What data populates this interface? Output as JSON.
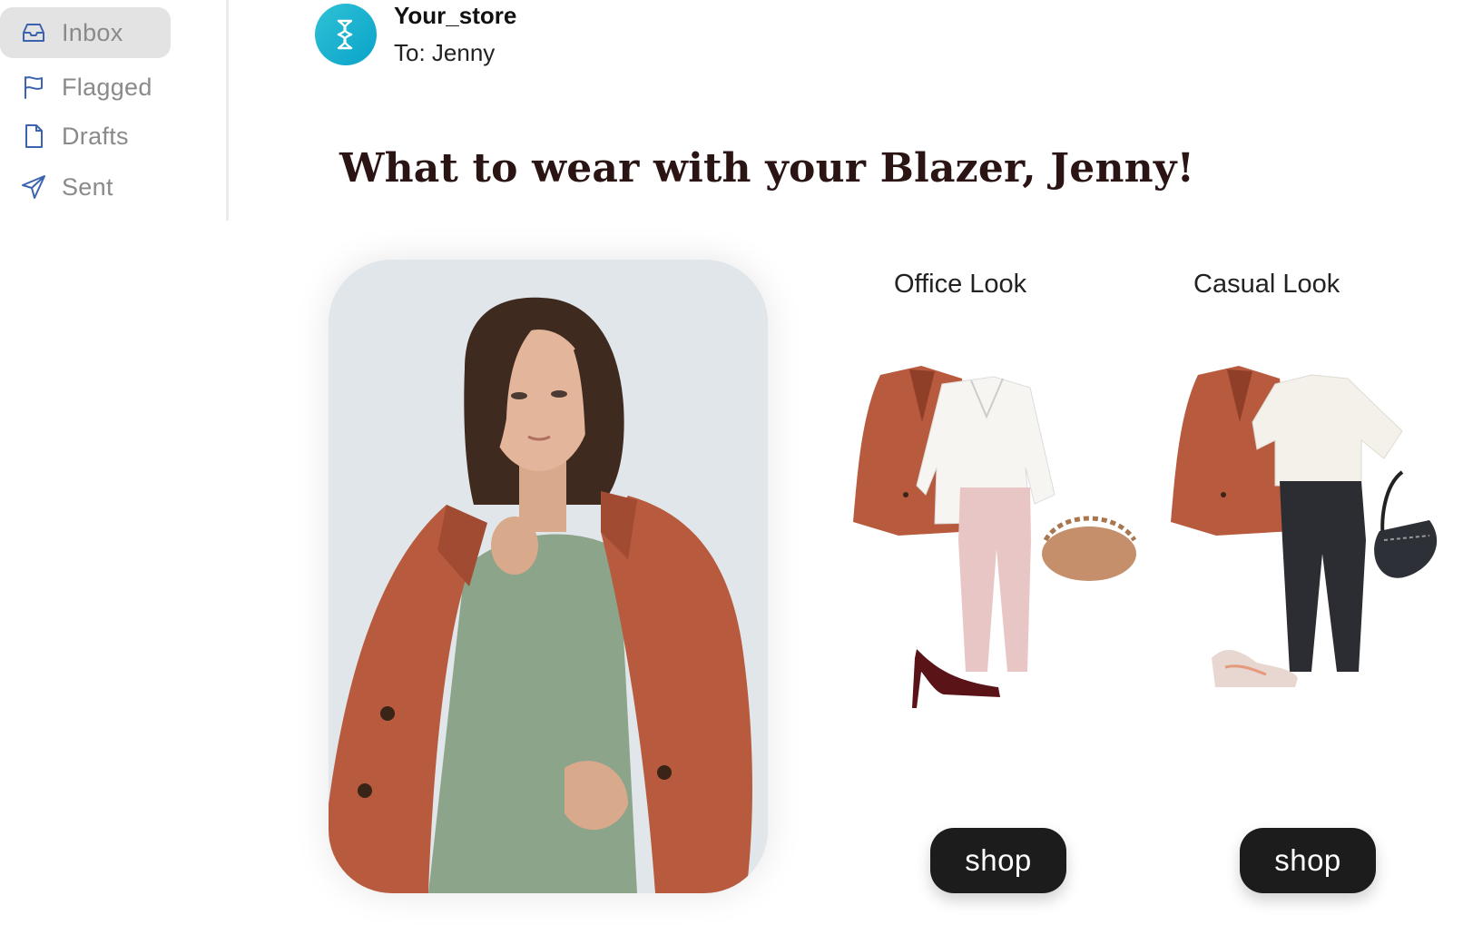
{
  "sidebar": {
    "items": [
      {
        "label": "Inbox",
        "icon": "inbox-icon"
      },
      {
        "label": "Flagged",
        "icon": "flag-icon"
      },
      {
        "label": "Drafts",
        "icon": "document-icon"
      },
      {
        "label": "Sent",
        "icon": "send-icon"
      }
    ]
  },
  "email": {
    "sender": "Your_store",
    "recipient": "To: Jenny",
    "headline": "What to wear with your Blazer, Jenny!"
  },
  "looks": [
    {
      "title": "Office Look",
      "button": "shop"
    },
    {
      "title": "Casual Look",
      "button": "shop"
    }
  ],
  "colors": {
    "accent": "#0aa3c9",
    "icon_blue": "#3b63b0",
    "button_bg": "#1c1c1c",
    "blazer": "#b85a3e",
    "dress": "#8ba48a"
  }
}
